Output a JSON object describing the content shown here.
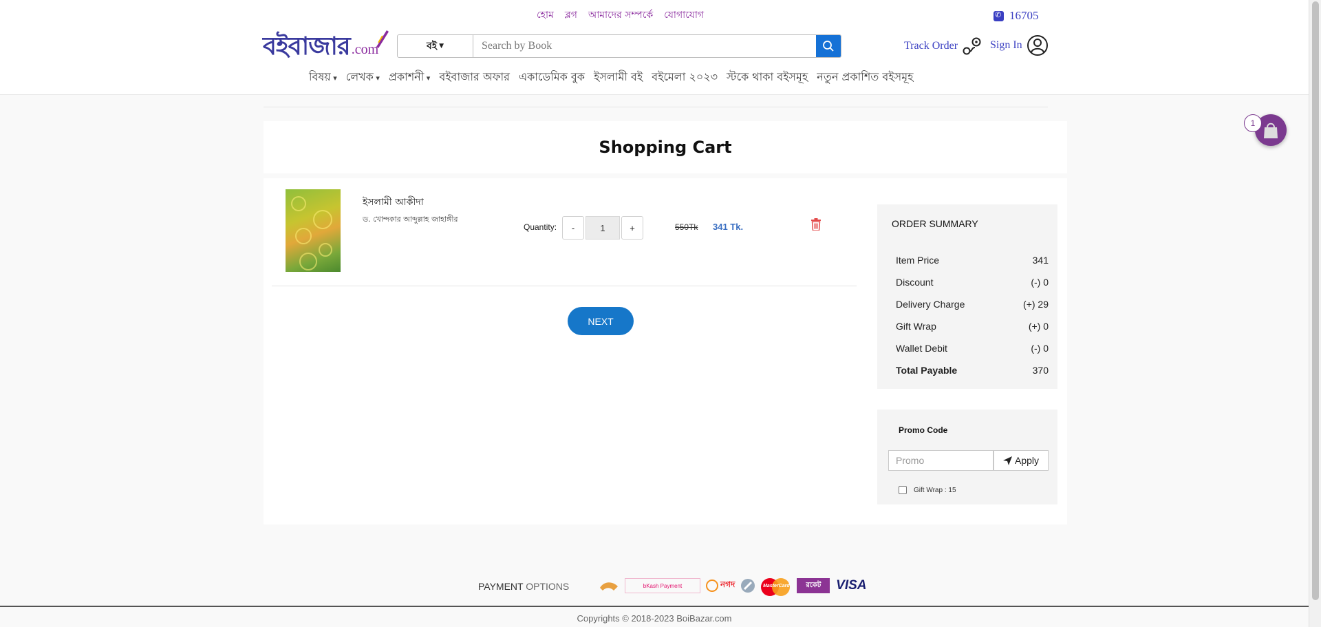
{
  "topnav": [
    "হোম",
    "ব্লগ",
    "আমাদের সম্পর্কে",
    "যোগাযোগ"
  ],
  "hotline": "16705",
  "logo": {
    "main": "বইবাজার",
    "suffix": ".com"
  },
  "search": {
    "category": "বই",
    "placeholder": "Search by Book"
  },
  "track_order": "Track Order",
  "sign_in": "Sign In",
  "mainnav": [
    {
      "label": "বিষয়",
      "dropdown": true
    },
    {
      "label": "লেখক",
      "dropdown": true
    },
    {
      "label": "প্রকাশনী",
      "dropdown": true
    },
    {
      "label": "বইবাজার অফার"
    },
    {
      "label": "একাডেমিক বুক"
    },
    {
      "label": "ইসলামী বই"
    },
    {
      "label": "বইমেলা ২০২৩"
    },
    {
      "label": "স্টকে থাকা বইসমূহ"
    },
    {
      "label": "নতুন প্রকাশিত বইসমূহ"
    }
  ],
  "cart": {
    "title": "Shopping Cart",
    "item": {
      "title": "ইসলামী আকীদা",
      "author": "ড. খোন্দকার আব্দুল্লাহ জাহাঙ্গীর",
      "quantity_label": "Quantity:",
      "quantity": "1",
      "minus": "-",
      "plus": "+",
      "old_price": "550Tk",
      "new_price": "341 Tk."
    },
    "next_label": "NEXT",
    "badge_count": "1"
  },
  "summary": {
    "title": "ORDER SUMMARY",
    "rows": [
      {
        "label": "Item Price",
        "value": "341"
      },
      {
        "label": "Discount",
        "value": "(-) 0"
      },
      {
        "label": "Delivery Charge",
        "value": "(+) 29"
      },
      {
        "label": "Gift Wrap",
        "value": "(+) 0"
      },
      {
        "label": "Wallet Debit",
        "value": "(-) 0"
      },
      {
        "label": "Total Payable",
        "value": "370"
      }
    ]
  },
  "promo": {
    "title": "Promo Code",
    "placeholder": "Promo",
    "apply_label": "Apply",
    "gift_wrap_label": "Gift Wrap : 15"
  },
  "footer": {
    "payment_1": "PAYMENT",
    "payment_2": "OPTIONS",
    "logos": [
      "bKash Payment",
      "নগদ",
      "MasterCard",
      "রকেট",
      "VISA"
    ],
    "copyright": "Copyrights © 2018-2023 BoiBazar.com"
  },
  "colors": {
    "brand_purple": "#8a2a9e",
    "brand_blue": "#3a3fc2",
    "button_blue": "#1677c9",
    "delete_red": "#e34b4b"
  }
}
